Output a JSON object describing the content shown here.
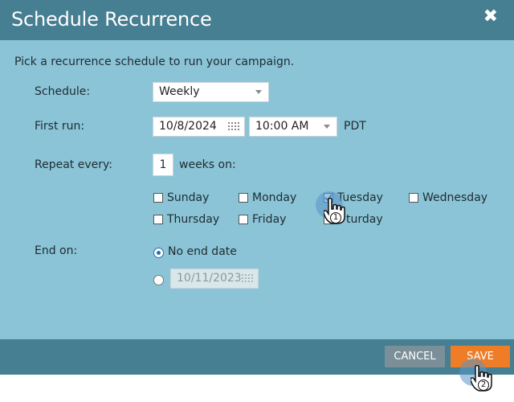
{
  "dialog": {
    "title": "Schedule Recurrence",
    "close_glyph": "✖",
    "intro": "Pick a recurrence schedule to run your campaign."
  },
  "schedule": {
    "label": "Schedule:",
    "value": "Weekly"
  },
  "first_run": {
    "label": "First run:",
    "date": "10/8/2024",
    "time": "10:00 AM",
    "timezone": "PDT"
  },
  "repeat": {
    "label": "Repeat every:",
    "value": "1",
    "suffix": "weeks on:"
  },
  "days": [
    {
      "label": "Sunday",
      "checked": false
    },
    {
      "label": "Monday",
      "checked": false
    },
    {
      "label": "Tuesday",
      "checked": true
    },
    {
      "label": "Wednesday",
      "checked": false
    },
    {
      "label": "Thursday",
      "checked": false
    },
    {
      "label": "Friday",
      "checked": false
    },
    {
      "label": "Saturday",
      "checked": false,
      "partly_hidden_text": "turday"
    }
  ],
  "end_on": {
    "label": "End on:",
    "no_end_label": "No end date",
    "end_date": "10/11/2023",
    "selected": "no_end"
  },
  "footer": {
    "cancel": "CANCEL",
    "save": "SAVE"
  },
  "cursors": {
    "first": "1",
    "second": "2"
  },
  "colors": {
    "header": "#467e92",
    "body": "#8bc4d6",
    "save": "#ef7d27",
    "cancel": "#7a8f97",
    "check": "#2a6cb0"
  }
}
